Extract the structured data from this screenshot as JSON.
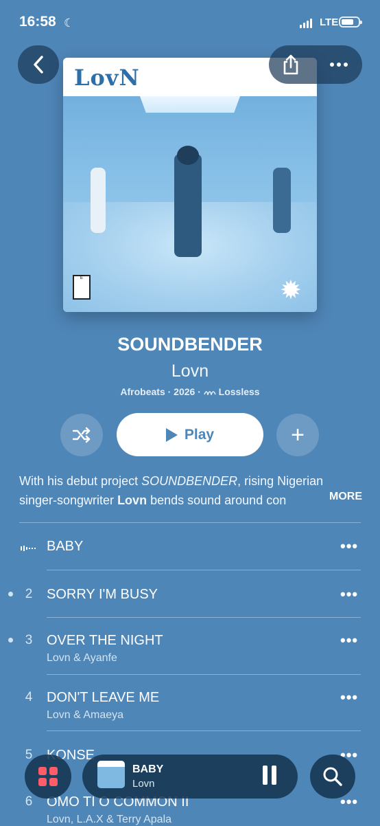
{
  "status": {
    "time": "16:58",
    "network": "LTE",
    "moon_icon": "moon-icon"
  },
  "album": {
    "artwork_logo": "LovN",
    "artwork_logo_small": "SOUNDBENDER",
    "title": "SOUNDBENDER",
    "artist": "Lovn",
    "meta_genre_year": "Afrobeats · 2026 · ",
    "meta_quality": "Lossless"
  },
  "controls": {
    "play_label": "Play",
    "add_symbol": "+"
  },
  "description": {
    "line1_pre": "With his debut project ",
    "line1_em": "SOUNDBENDER",
    "line1_post": ", rising Nigerian",
    "line2_pre": "singer-songwriter ",
    "line2_strong": "Lovn",
    "line2_post": " bends sound around con",
    "more_label": "MORE"
  },
  "tracks": [
    {
      "number": "",
      "title": "BABY",
      "artist": "",
      "playing": true
    },
    {
      "number": "2",
      "title": "SORRY I'M BUSY",
      "artist": ""
    },
    {
      "number": "3",
      "title": "OVER THE NIGHT",
      "artist": "Lovn & Ayanfe"
    },
    {
      "number": "4",
      "title": "DON'T LEAVE ME",
      "artist": "Lovn & Amaeya"
    },
    {
      "number": "5",
      "title": "KONSE",
      "artist": ""
    },
    {
      "number": "6",
      "title": "OMO TI O COMMON II",
      "artist": "Lovn, L.A.X & Terry Apala"
    }
  ],
  "track_more": "•••",
  "mini_player": {
    "title": "BABY",
    "artist": "Lovn"
  },
  "icons": {
    "back": "chevron-left-icon",
    "share": "share-icon",
    "more": "ellipsis-icon",
    "shuffle": "shuffle-icon",
    "add": "plus-icon",
    "grid": "grid-icon",
    "pause": "pause-icon",
    "search": "search-icon"
  },
  "colors": {
    "background": "#4f86b8",
    "accent_grid": "#ff5c6a"
  }
}
